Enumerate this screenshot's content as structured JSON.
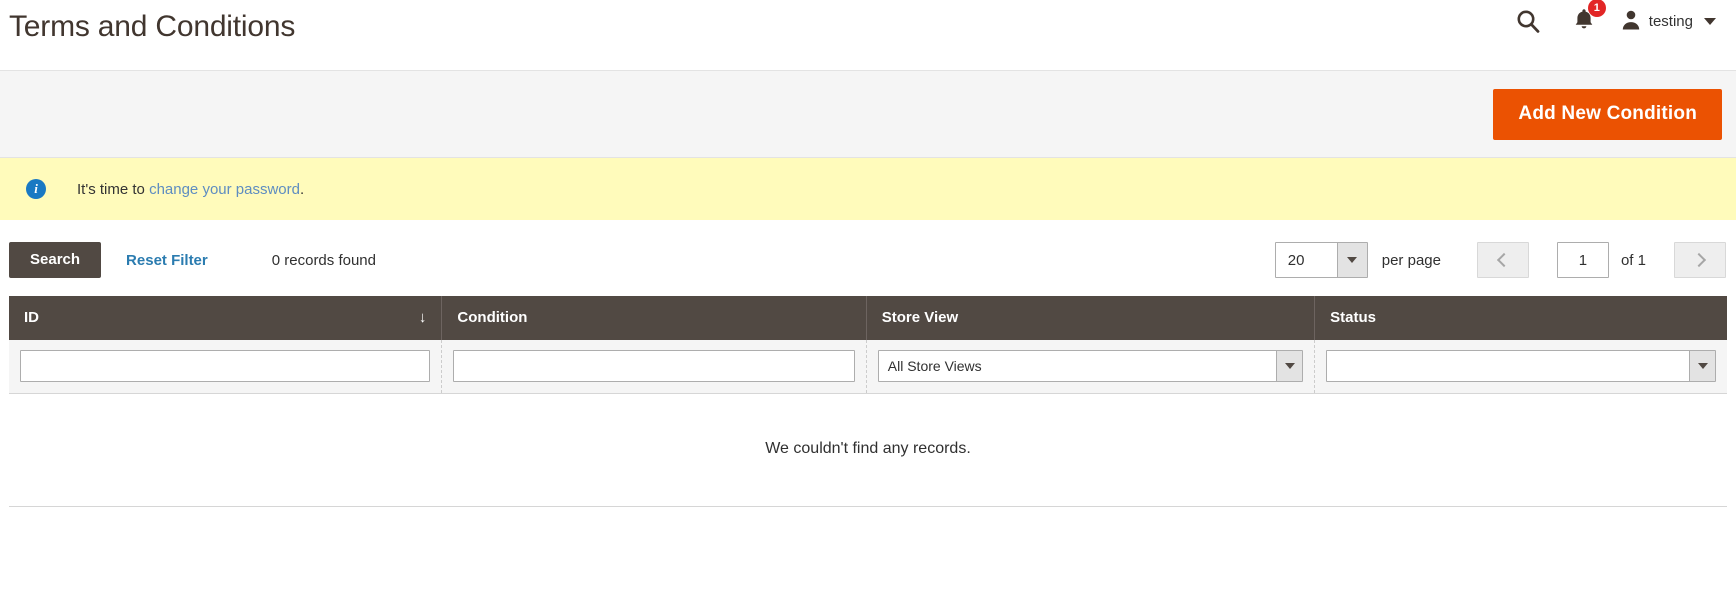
{
  "header": {
    "title": "Terms and Conditions",
    "search_icon": "search-icon",
    "notifications_icon": "bell-icon",
    "notifications_count": "1",
    "avatar_icon": "user-avatar-icon",
    "user_name": "testing",
    "caret_icon": "chevron-down-icon"
  },
  "action_bar": {
    "add_new_label": "Add New Condition",
    "accent_color": "#eb5202"
  },
  "notice": {
    "icon": "info-circle-icon",
    "text_before": "It's time to ",
    "link_text": "change your password",
    "text_after": ".",
    "background": "#fffbbb",
    "icon_color": "#1979c3"
  },
  "toolbar": {
    "search_label": "Search",
    "reset_filter_label": "Reset Filter",
    "records_found": "0 records found",
    "per_page_value": "20",
    "per_page_label": "per page",
    "prev_icon": "chevron-left-icon",
    "next_icon": "chevron-right-icon",
    "page_value": "1",
    "of_total": "of 1"
  },
  "grid": {
    "columns": [
      {
        "label": "ID",
        "sort_indicator": "↓"
      },
      {
        "label": "Condition",
        "sort_indicator": ""
      },
      {
        "label": "Store View",
        "sort_indicator": ""
      },
      {
        "label": "Status",
        "sort_indicator": ""
      }
    ],
    "filters": {
      "id_value": "",
      "condition_value": "",
      "store_view_value": "All Store Views",
      "status_value": ""
    },
    "empty_message": "We couldn't find any records.",
    "header_background": "#514943"
  }
}
